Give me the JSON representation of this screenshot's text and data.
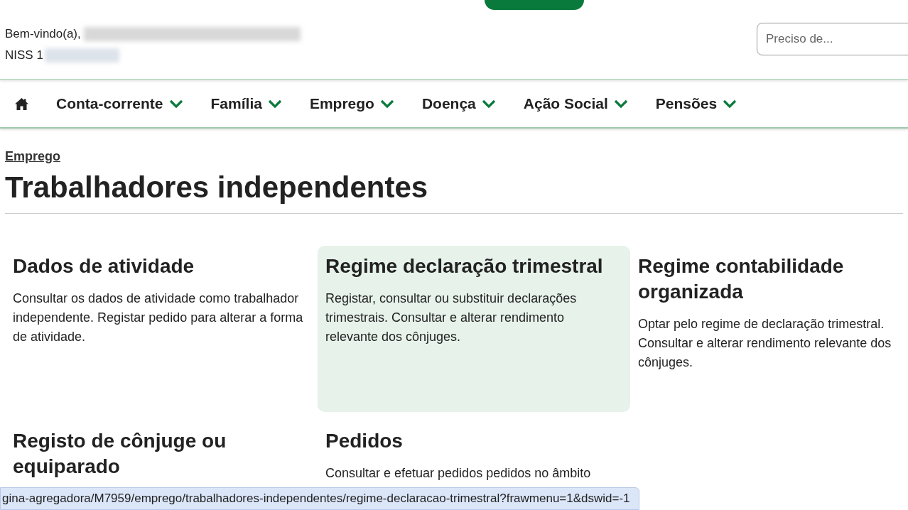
{
  "welcome": {
    "greeting": "Bem-vindo(a),",
    "niss_label": "NISS 1"
  },
  "search": {
    "placeholder": "Preciso de..."
  },
  "nav": {
    "items": [
      {
        "label": "Conta-corrente"
      },
      {
        "label": "Família"
      },
      {
        "label": "Emprego"
      },
      {
        "label": "Doença"
      },
      {
        "label": "Ação Social"
      },
      {
        "label": "Pensões"
      }
    ]
  },
  "breadcrumb": "Emprego",
  "title": "Trabalhadores independentes",
  "cards": [
    {
      "title": "Dados de atividade",
      "description": "Consultar os dados de atividade como trabalhador independente. Registar pedido para alterar a forma de atividade.",
      "highlighted": false
    },
    {
      "title": "Regime declaração trimestral",
      "description": "Registar, consultar ou substituir declarações trimestrais. Consultar e alterar rendimento relevante dos cônjuges.",
      "highlighted": true
    },
    {
      "title": "Regime contabilidade organizada",
      "description": "Optar pelo regime de declaração trimestral. Consultar e alterar rendimento relevante dos cônjuges.",
      "highlighted": false
    },
    {
      "title": "Registo de cônjuge ou equiparado",
      "highlighted": false
    },
    {
      "title": "Pedidos",
      "description": "Consultar e efetuar pedidos pedidos no âmbito",
      "highlighted": false
    }
  ],
  "status_url": "gina-agregadora/M7959/emprego/trabalhadores-independentes/regime-declaracao-trimestral?frawmenu=1&dswid=-1"
}
